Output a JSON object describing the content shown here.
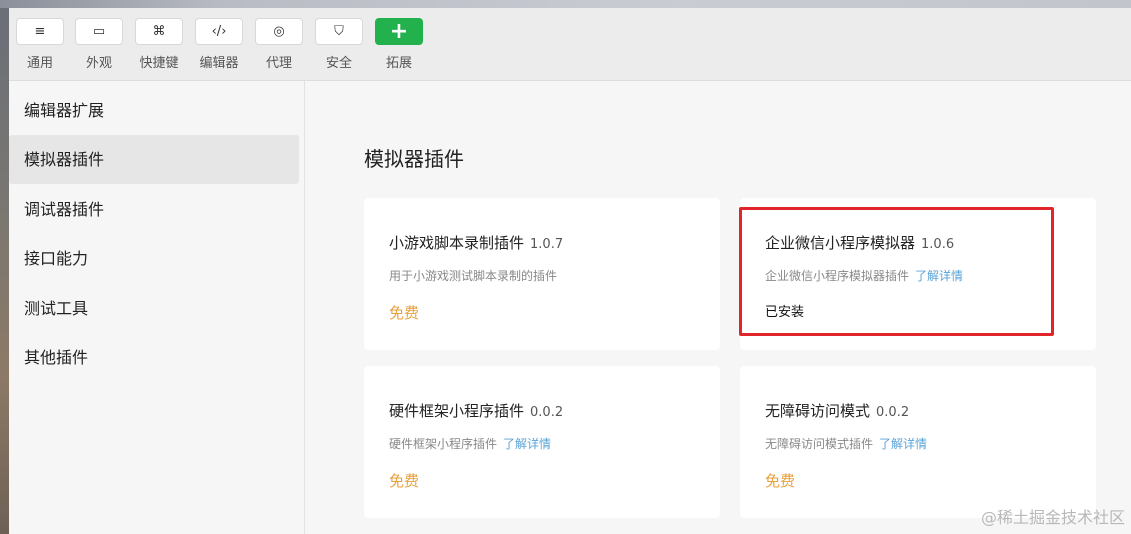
{
  "toolbar": {
    "tabs": [
      {
        "label": "通用",
        "icon": "≡"
      },
      {
        "label": "外观",
        "icon": "▭"
      },
      {
        "label": "快捷键",
        "icon": "⌘"
      },
      {
        "label": "编辑器",
        "icon": "‹/›"
      },
      {
        "label": "代理",
        "icon": "◎"
      },
      {
        "label": "安全",
        "icon": "⛉"
      },
      {
        "label": "拓展",
        "icon": "+"
      }
    ]
  },
  "sidebar": {
    "items": [
      {
        "label": "编辑器扩展"
      },
      {
        "label": "模拟器插件",
        "active": true
      },
      {
        "label": "调试器插件"
      },
      {
        "label": "接口能力"
      },
      {
        "label": "测试工具"
      },
      {
        "label": "其他插件"
      }
    ]
  },
  "main": {
    "title": "模拟器插件",
    "cards": [
      {
        "name": "小游戏脚本录制插件",
        "version": "1.0.7",
        "desc": "用于小游戏测试脚本录制的插件",
        "link": "",
        "status": "免费"
      },
      {
        "name": "企业微信小程序模拟器",
        "version": "1.0.6",
        "desc": "企业微信小程序模拟器插件",
        "link": "了解详情",
        "status": "已安装"
      },
      {
        "name": "硬件框架小程序插件",
        "version": "0.0.2",
        "desc": "硬件框架小程序插件",
        "link": "了解详情",
        "status": "免费"
      },
      {
        "name": "无障碍访问模式",
        "version": "0.0.2",
        "desc": "无障碍访问模式插件",
        "link": "了解详情",
        "status": "免费"
      }
    ]
  },
  "watermark": "@稀土掘金技术社区",
  "colors": {
    "accent": "#22b14c",
    "free": "#e8a03b",
    "link": "#5aa3d7",
    "highlight": "#e0262a"
  }
}
